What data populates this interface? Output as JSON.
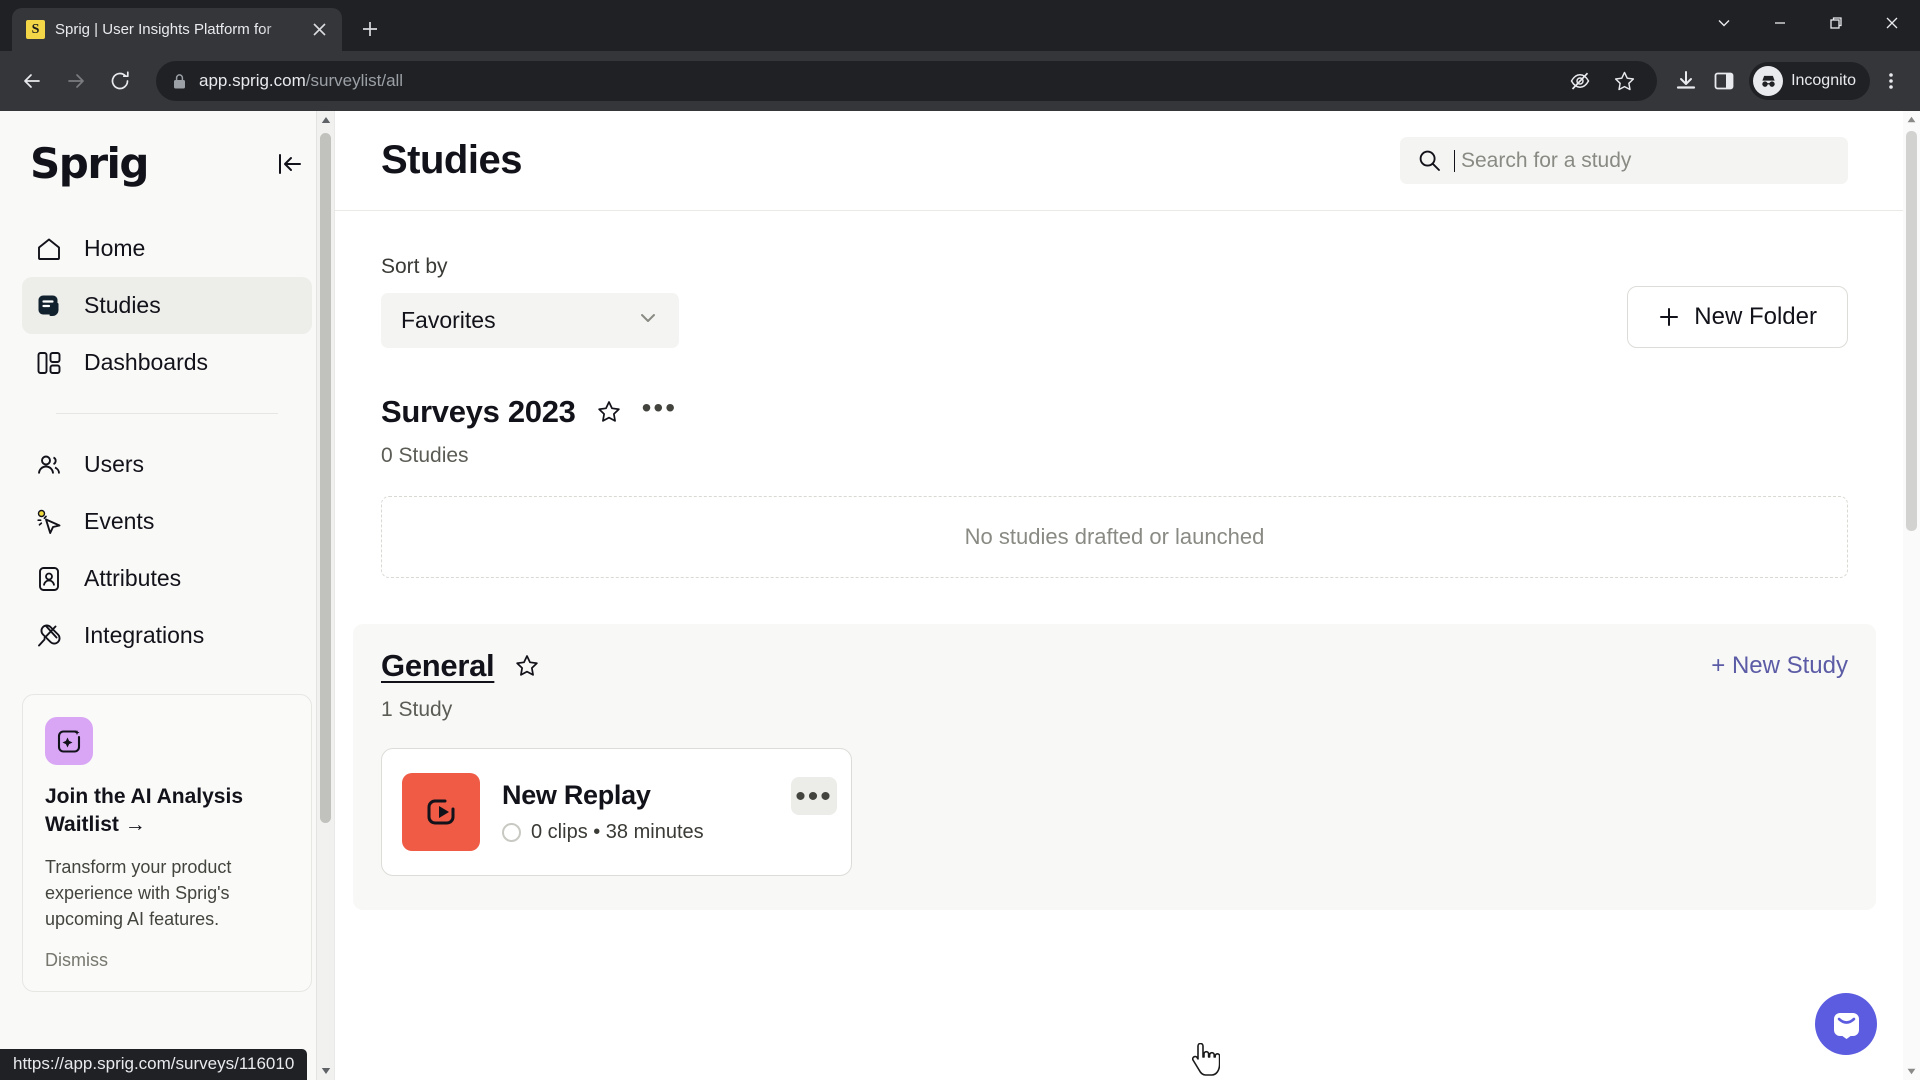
{
  "browser": {
    "tab": {
      "favicon_letter": "S",
      "title": "Sprig | User Insights Platform for",
      "close_icon": "close-icon"
    },
    "new_tab_label": "+",
    "window_controls": [
      "chevron-down-icon",
      "minimize-icon",
      "maximize-icon",
      "close-icon"
    ],
    "toolbar": {
      "back_icon": "back-arrow-icon",
      "forward_icon": "forward-arrow-icon",
      "reload_icon": "reload-icon",
      "lock_icon": "lock-icon",
      "url_host": "app.sprig.com",
      "url_path": "/surveylist/all",
      "actions": [
        "eye-slash-icon",
        "bookmark-star-icon",
        "download-icon",
        "side-panel-icon"
      ],
      "profile_label": "Incognito",
      "menu_icon": "three-dot-menu-icon"
    },
    "status_url": "https://app.sprig.com/surveys/116010"
  },
  "sidebar": {
    "logo": "Sprig",
    "collapse_icon": "collapse-sidebar-icon",
    "items": [
      {
        "label": "Home",
        "icon": "home-icon",
        "active": false
      },
      {
        "label": "Studies",
        "icon": "studies-icon",
        "active": true
      },
      {
        "label": "Dashboards",
        "icon": "dashboards-icon",
        "active": false
      },
      {
        "label": "Users",
        "icon": "users-icon",
        "active": false
      },
      {
        "label": "Events",
        "icon": "events-cursor-icon",
        "active": false
      },
      {
        "label": "Attributes",
        "icon": "attributes-badge-icon",
        "active": false
      },
      {
        "label": "Integrations",
        "icon": "integrations-plug-icon",
        "active": false
      }
    ],
    "promo": {
      "badge_icon": "ai-sparkle-icon",
      "title": "Join the AI Analysis Waitlist →",
      "body": "Transform your product experience with Sprig's upcoming AI features.",
      "dismiss_label": "Dismiss",
      "badge_color": "#D9A6F5"
    }
  },
  "header": {
    "title": "Studies",
    "search": {
      "icon": "search-icon",
      "placeholder": "Search for a study",
      "value": ""
    }
  },
  "controls": {
    "sort_label": "Sort by",
    "sort_value": "Favorites",
    "sort_chevron": "chevron-down-icon",
    "new_folder_label": "New Folder",
    "new_folder_plus": "plus-icon"
  },
  "folders": [
    {
      "name": "Surveys 2023",
      "hovered": false,
      "star_icon": "star-outline-icon",
      "menu_icon": "three-dot-menu-icon",
      "count_label": "0 Studies",
      "empty_message": "No studies drafted or launched",
      "studies": []
    },
    {
      "name": "General",
      "hovered": true,
      "star_icon": "star-outline-icon",
      "count_label": "1 Study",
      "new_study_label": "+ New Study",
      "new_study_color": "#5B5BA6",
      "studies": [
        {
          "name": "New Replay",
          "thumb_icon": "replay-icon",
          "thumb_color": "#EF5B45",
          "status_icon": "status-circle-icon",
          "meta": "0 clips • 38 minutes",
          "menu_icon": "three-dot-menu-icon"
        }
      ]
    }
  ],
  "intercom": {
    "icon": "chat-bubble-icon",
    "color": "#5C5CE0"
  }
}
